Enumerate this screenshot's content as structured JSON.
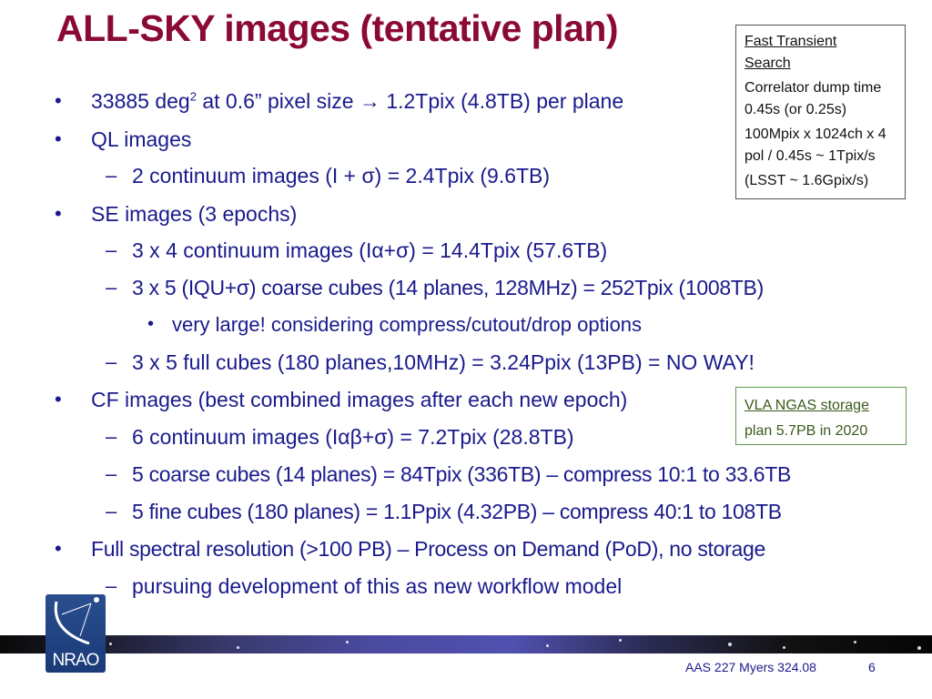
{
  "slide": {
    "title": "ALL-SKY images (tentative plan)",
    "bullets": [
      {
        "level": 1,
        "parts": [
          "33885 deg",
          "2",
          " at 0.6” pixel size → 1.2Tpix (4.8TB) per plane"
        ]
      },
      {
        "level": 1,
        "text": "QL images"
      },
      {
        "level": 2,
        "text": "2 continuum images (I + σ) = 2.4Tpix (9.6TB)"
      },
      {
        "level": 1,
        "text": "SE images (3 epochs)"
      },
      {
        "level": 2,
        "text": "3 x 4 continuum images (Iα+σ) = 14.4Tpix (57.6TB)"
      },
      {
        "level": 2,
        "text": "3 x 5 (IQU+σ) coarse cubes (14 planes, 128MHz) = 252Tpix (1008TB)"
      },
      {
        "level": 3,
        "text": "very large! considering compress/cutout/drop options"
      },
      {
        "level": 2,
        "text": "3 x 5 full cubes (180 planes,10MHz) = 3.24Ppix (13PB) = NO WAY!"
      },
      {
        "level": 1,
        "text": "CF images (best combined images after each new epoch)"
      },
      {
        "level": 2,
        "text": "6 continuum images (Iαβ+σ) = 7.2Tpix (28.8TB)"
      },
      {
        "level": 2,
        "text": "5 coarse cubes (14 planes) = 84Tpix (336TB) – compress 10:1 to 33.6TB"
      },
      {
        "level": 2,
        "text": "5 fine cubes (180 planes) = 1.1Ppix (4.32PB) – compress 40:1 to 108TB"
      },
      {
        "level": 1,
        "text": "Full spectral resolution (>100 PB) – Process on Demand (PoD), no storage"
      },
      {
        "level": 2,
        "text": "pursuing development of this as new workflow model"
      }
    ],
    "bullet_marks": {
      "level1": "•",
      "level2": "–",
      "level3": "•"
    },
    "transient_box": {
      "heading_line1": "Fast Transient",
      "heading_line2": "Search",
      "para1": "Correlator dump time 0.45s (or 0.25s)",
      "para2": "100Mpix x 1024ch x 4 pol / 0.45s ~ 1Tpix/s",
      "para3": "(LSST ~ 1.6Gpix/s)"
    },
    "storage_box": {
      "heading": "VLA NGAS storage",
      "text": "plan 5.7PB in 2020"
    },
    "footer": {
      "citation": "AAS 227 Myers 324.08",
      "page_number": "6"
    },
    "logo": {
      "text": "NRAO"
    },
    "colors": {
      "title": "#8b0a35",
      "body": "#1a1a8c",
      "storage_border": "#5a9a4a"
    }
  }
}
